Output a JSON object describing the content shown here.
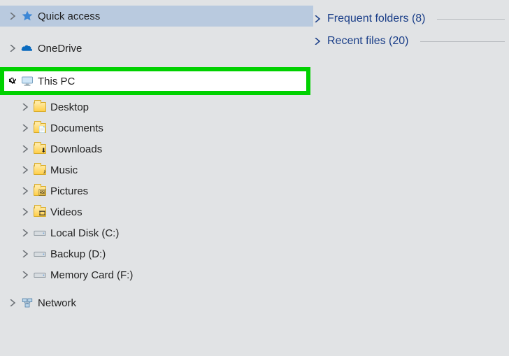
{
  "nav": {
    "quick_access": "Quick access",
    "onedrive": "OneDrive",
    "this_pc": "This PC",
    "desktop": "Desktop",
    "documents": "Documents",
    "downloads": "Downloads",
    "music": "Music",
    "pictures": "Pictures",
    "videos": "Videos",
    "local_disk": "Local Disk (C:)",
    "backup": "Backup (D:)",
    "memory_card": "Memory Card (F:)",
    "network": "Network"
  },
  "content": {
    "frequent": "Frequent folders (8)",
    "recent": "Recent files (20)"
  }
}
